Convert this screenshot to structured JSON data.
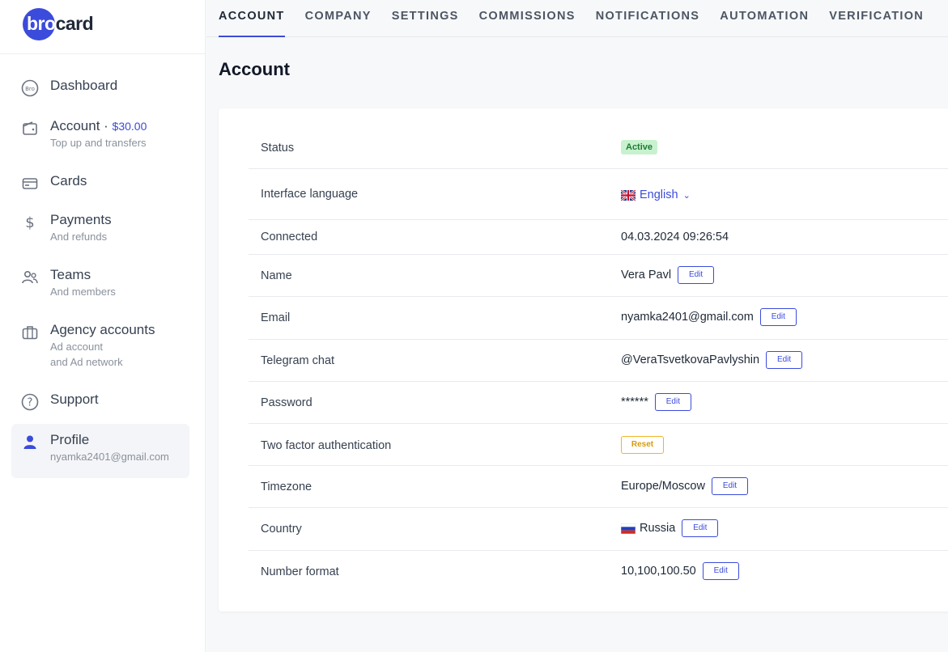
{
  "logo": {
    "prefix": "bro",
    "suffix": "card"
  },
  "sidebar": {
    "items": [
      {
        "title": "Dashboard",
        "icon": "bro-badge-icon"
      },
      {
        "title": "Account · ",
        "balance": "$30.00",
        "sub": "Top up and transfers",
        "icon": "wallet-icon"
      },
      {
        "title": "Cards",
        "icon": "card-icon"
      },
      {
        "title": "Payments",
        "sub": "And refunds",
        "icon": "dollar-icon"
      },
      {
        "title": "Teams",
        "sub": "And members",
        "icon": "users-icon"
      },
      {
        "title": "Agency accounts",
        "sub": "Ad account",
        "sub2": "and Ad network",
        "icon": "briefcase-icon"
      },
      {
        "title": "Support",
        "icon": "help-circle-icon"
      },
      {
        "title": "Profile",
        "sub": "nyamka2401@gmail.com",
        "icon": "user-icon"
      }
    ]
  },
  "tabs": [
    "ACCOUNT",
    "COMPANY",
    "SETTINGS",
    "COMMISSIONS",
    "NOTIFICATIONS",
    "AUTOMATION",
    "VERIFICATION"
  ],
  "page_title": "Account",
  "rows": {
    "status": {
      "label": "Status",
      "value": "Active"
    },
    "language": {
      "label": "Interface language",
      "value": "English"
    },
    "connected": {
      "label": "Connected",
      "value": "04.03.2024 09:26:54"
    },
    "name": {
      "label": "Name",
      "value": "Vera Pavl"
    },
    "email": {
      "label": "Email",
      "value": "nyamka2401@gmail.com"
    },
    "telegram": {
      "label": "Telegram chat",
      "value": "@VeraTsvetkovaPavlyshin"
    },
    "password": {
      "label": "Password",
      "value": "******"
    },
    "twofa": {
      "label": "Two factor authentication",
      "value": "Reset"
    },
    "timezone": {
      "label": "Timezone",
      "value": "Europe/Moscow"
    },
    "country": {
      "label": "Country",
      "value": "Russia"
    },
    "number_format": {
      "label": "Number format",
      "value": "10,100,100.50"
    }
  },
  "edit_label": "Edit",
  "colors": {
    "accent": "#3b4bdb",
    "active_bg": "#c8f2cf",
    "reset_border": "#f0b429"
  }
}
